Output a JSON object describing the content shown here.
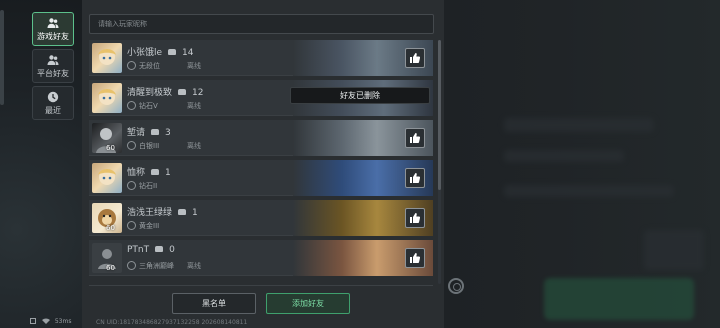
{
  "tabs": [
    {
      "label": "游戏好友",
      "icon": "people-icon",
      "active": true
    },
    {
      "label": "平台好友",
      "icon": "people-icon",
      "active": false
    },
    {
      "label": "最近",
      "icon": "clock-icon",
      "active": false
    }
  ],
  "search": {
    "placeholder": "请输入玩家昵称"
  },
  "friends": [
    {
      "name": "小张饿le",
      "count": "14",
      "rank": "无段位",
      "status": "离线",
      "level": "",
      "avatar": "cartoon",
      "banner": "#5b6a7c"
    },
    {
      "name": "清醒到极致",
      "count": "12",
      "rank": "钻石V",
      "status": "离线",
      "level": "",
      "avatar": "cartoon",
      "banner": "#4f5b6a"
    },
    {
      "name": "堑请",
      "count": "3",
      "rank": "白银III",
      "status": "离线",
      "level": "60",
      "avatar": "bw",
      "banner": "#6f7a84"
    },
    {
      "name": "恤称",
      "count": "1",
      "rank": "钻石II",
      "status": "离线",
      "level": "",
      "avatar": "cartoon",
      "banner": "#3d5a88"
    },
    {
      "name": "浩浅王绿绿",
      "count": "1",
      "rank": "黄金III",
      "status": "离线",
      "level": "60",
      "avatar": "dog",
      "banner": "#8a6a2e"
    },
    {
      "name": "PTnT",
      "count": "0",
      "rank": "三角洲巅峰",
      "status": "离线",
      "level": "60",
      "avatar": "plain",
      "banner": "#9a6a4c"
    }
  ],
  "buttons": {
    "blacklist": "黑名单",
    "add_friend": "添加好友"
  },
  "toast": "好友已删除",
  "footer": {
    "uid": "CN UID:181783486827937132258 202608140811",
    "ping": "53ms"
  },
  "colors": {
    "accent": "#5cc08b",
    "panel": "#2a2e31",
    "row": "#31363a"
  }
}
